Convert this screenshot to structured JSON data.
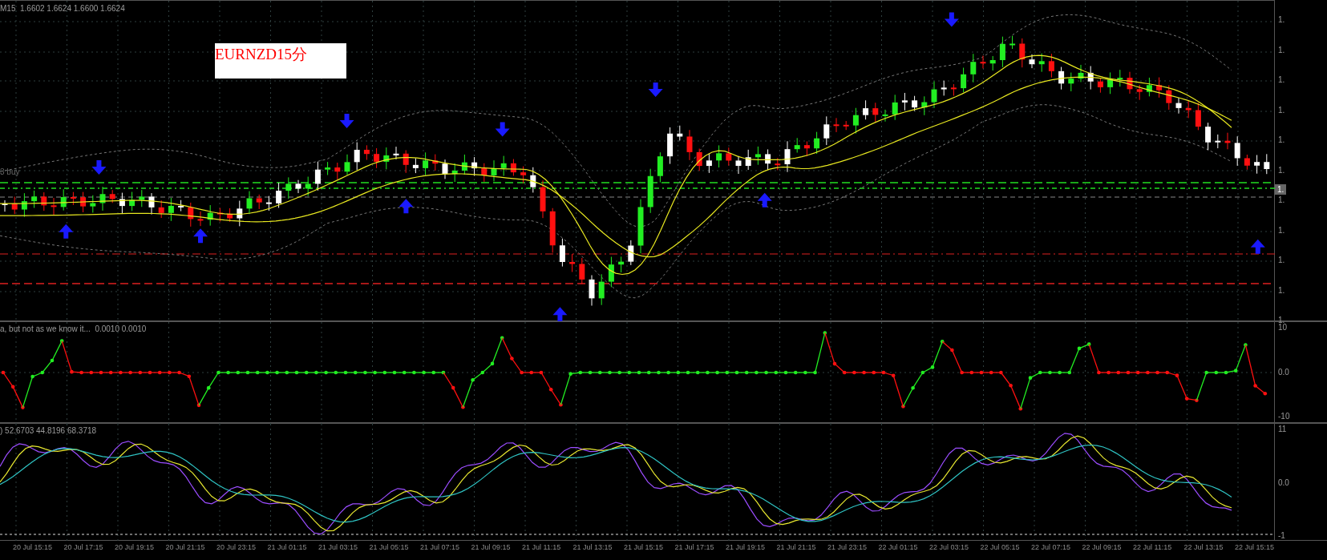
{
  "main_panel": {
    "header": "M15  1.6602 1.6624 1.6600 1.6624",
    "label": "EURNZD15分",
    "line_label": "3 buy",
    "price_axis": [
      "1.",
      "1.",
      "1.",
      "1.",
      "1.",
      "1.",
      "1.",
      "1.",
      "1.",
      "1.",
      "1."
    ],
    "current_price": "1."
  },
  "indicator_1": {
    "header": "a, but not as we know it...  0.0010 0.0010",
    "axis": [
      "10",
      "0.0",
      "-10"
    ]
  },
  "indicator_2": {
    "header": ") 52.6703 44.8196 68.3718",
    "axis": [
      "11",
      "0.0",
      "-1"
    ]
  },
  "time_axis": [
    "20 Jul 15:15",
    "20 Jul 17:15",
    "20 Jul 19:15",
    "20 Jul 21:15",
    "20 Jul 23:15",
    "21 Jul 01:15",
    "21 Jul 03:15",
    "21 Jul 05:15",
    "21 Jul 07:15",
    "21 Jul 09:15",
    "21 Jul 11:15",
    "21 Jul 13:15",
    "21 Jul 15:15",
    "21 Jul 17:15",
    "21 Jul 19:15",
    "21 Jul 21:15",
    "21 Jul 23:15",
    "22 Jul 01:15",
    "22 Jul 03:15",
    "22 Jul 05:15",
    "22 Jul 07:15",
    "22 Jul 09:15",
    "22 Jul 11:15",
    "22 Jul 13:15",
    "22 Jul 15:15"
  ]
}
